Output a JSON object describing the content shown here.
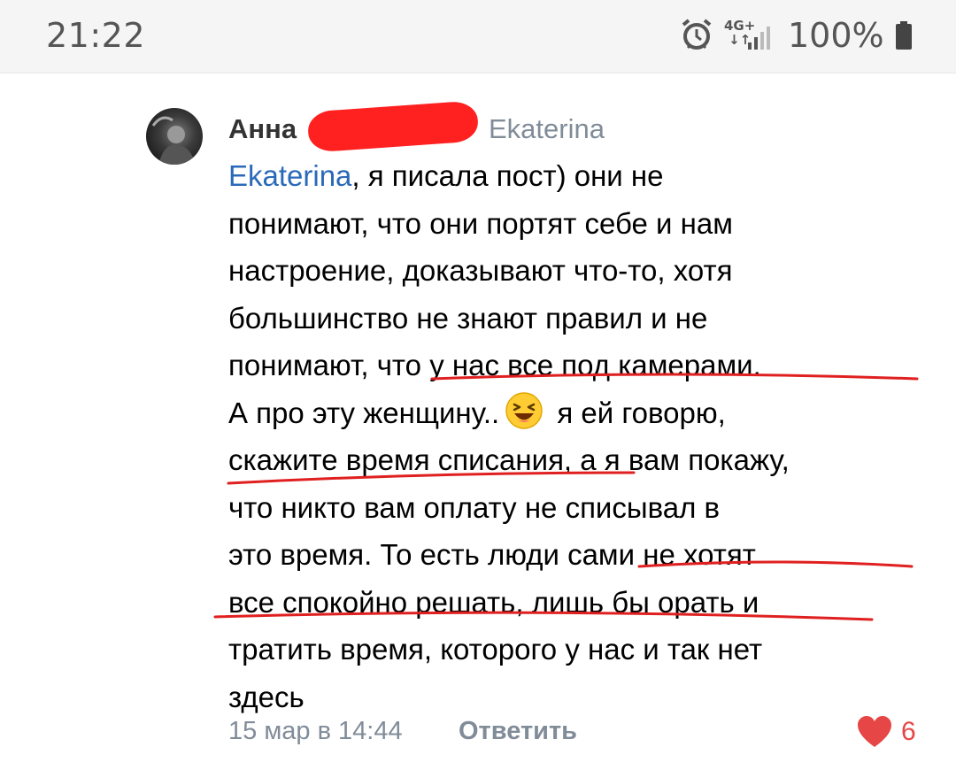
{
  "status_bar": {
    "time": "21:22",
    "network": "4G+",
    "battery": "100%"
  },
  "comment": {
    "author": "Анна",
    "reply_to": "Ekaterina",
    "mention": "Ekaterina",
    "line1_rest": ", я писала пост) они не",
    "lines": [
      "понимают, что они портят себе и нам",
      "настроение, доказывают что-то, хотя",
      "большинство не знают правил и не",
      "понимают, что у нас все под камерами.",
      "А про эту женщину..",
      " я ей говорю,",
      "скажите время списания, а я вам покажу,",
      "что никто вам оплату не списывал в",
      "это время. То есть люди сами не хотят",
      "все спокойно решать, лишь бы орать и",
      "тратить время, которого у нас и так нет",
      "здесь"
    ],
    "date": "15 мар в 14:44",
    "reply_label": "Ответить",
    "likes": "6"
  },
  "colors": {
    "accent": "#2a6ab8",
    "secondary": "#818c99",
    "like": "#e64646",
    "annotation": "#e02020"
  },
  "icons": [
    "alarm-icon",
    "signal-icon",
    "battery-icon",
    "laughing-emoji-icon",
    "heart-icon"
  ]
}
